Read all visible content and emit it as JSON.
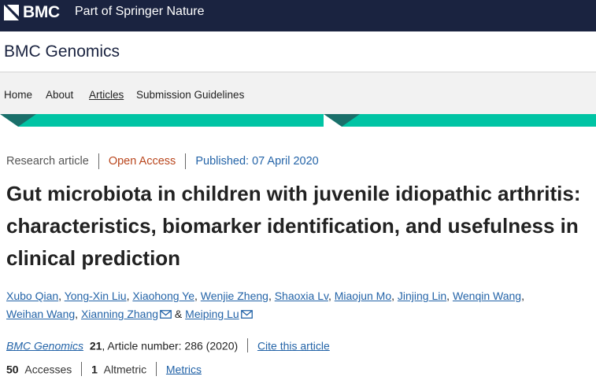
{
  "header": {
    "brand": "BMC",
    "tagline": "Part of Springer Nature",
    "journal_title": "BMC Genomics"
  },
  "nav": {
    "items": [
      "Home",
      "About",
      "Articles",
      "Submission Guidelines"
    ],
    "active": "Articles"
  },
  "article": {
    "type": "Research article",
    "access": "Open Access",
    "published": "Published: 07 April 2020",
    "title": "Gut microbiota in children with juvenile idiopathic arthritis: characteristics, biomarker identification, and usefulness in clinical prediction",
    "authors": [
      "Xubo Qian",
      "Yong-Xin Liu",
      "Xiaohong Ye",
      "Wenjie Zheng",
      "Shaoxia Lv",
      "Miaojun Mo",
      "Jinjing Lin",
      "Wenqin Wang",
      "Weihan Wang",
      "Xianning Zhang",
      "Meiping Lu"
    ],
    "author_join": "&",
    "journal": "BMC Genomics",
    "volume": "21",
    "article_number": ", Article number: 286 (2020)",
    "cite_label": "Cite this article"
  },
  "metrics": {
    "accesses_count": "50",
    "accesses_label": "Accesses",
    "altmetric_count": "1",
    "altmetric_label": "Altmetric",
    "metrics_link": "Metrics"
  },
  "colors": {
    "header_bg": "#1a2340",
    "teal": "#00c4a4",
    "link": "#2464a8",
    "open_access": "#b9461d"
  },
  "icons": [
    "bmc-logo-icon",
    "mail-icon"
  ]
}
